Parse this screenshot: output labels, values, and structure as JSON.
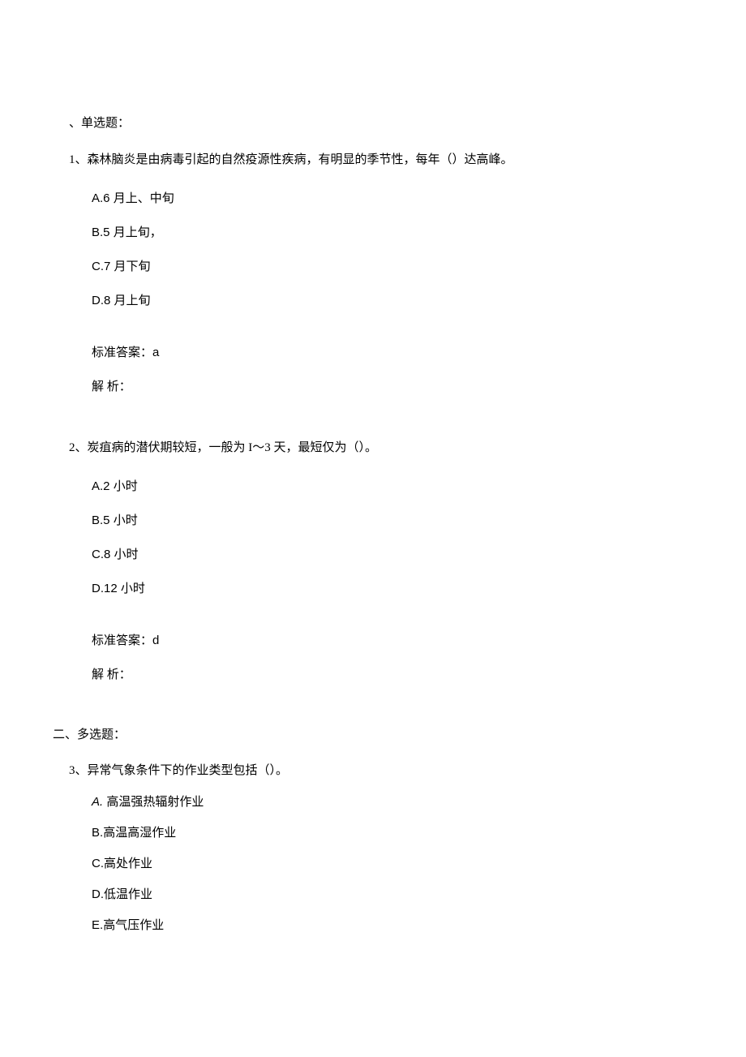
{
  "section1": {
    "header": "、单选题："
  },
  "q1": {
    "text": "1、森林脑炎是由病毒引起的自然疫源性疾病，有明显的季节性，每年（）达高峰。",
    "optA_prefix": "A.6 ",
    "optA_text": "月上、中旬",
    "optB_prefix": "B.5 ",
    "optB_text": "月上旬，",
    "optC_prefix": "C.7 ",
    "optC_text": "月下旬",
    "optD_prefix": "D.8 ",
    "optD_text": "月上旬",
    "answer_label": "标准答案：",
    "answer_value": "a",
    "analysis_label": "解 析："
  },
  "q2": {
    "text_p1": "2、炭疽病的潜伏期较短，一般为 ",
    "text_l": "I〜3 ",
    "text_p2": "天，最短仅为（）。",
    "optA_prefix": "A.2 ",
    "optA_text": "小时",
    "optB_prefix": "B.5 ",
    "optB_text": "小时",
    "optC_prefix": "C.8 ",
    "optC_text": "小时",
    "optD_prefix": "D.12 ",
    "optD_text": "小时",
    "answer_label": "标准答案：",
    "answer_value": "d",
    "analysis_label": "解 析："
  },
  "section2": {
    "header": "二、多选题："
  },
  "q3": {
    "text": "3、异常气象条件下的作业类型包括（）。",
    "optA_prefix": "A. ",
    "optA_text": "高温强热辐射作业",
    "optB_prefix": "B.",
    "optB_text": "高温高湿作业",
    "optC_prefix": "C.",
    "optC_text": "高处作业",
    "optD_prefix": "D.",
    "optD_text": "低温作业",
    "optE_prefix": "E.",
    "optE_text": "高气压作业"
  }
}
